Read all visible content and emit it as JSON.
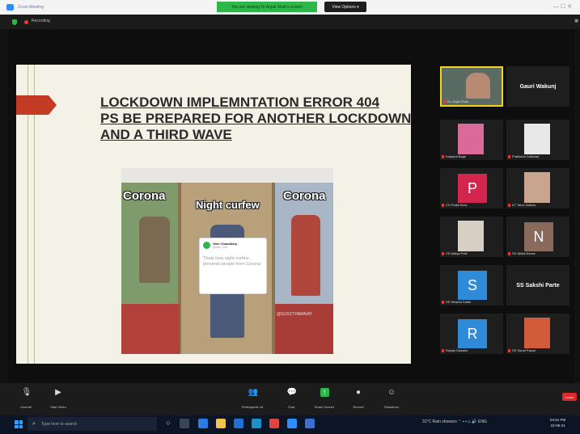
{
  "window": {
    "title": "Zoom Meeting"
  },
  "share_banner": {
    "label": "You are viewing Dr Anjali Shah's screen",
    "view_options": "View Options ▾"
  },
  "rec_bar": {
    "recording": "Recording"
  },
  "slide": {
    "title_lines": [
      "LOCKDOWN IMPLEMNTATION ERROR 404",
      "PS BE PREPARED FOR ANOTHER LOCKDOWN",
      "AND A THIRD WAVE"
    ],
    "meme_labels": {
      "left": "Corona",
      "middle": "Night curfew",
      "right": "Corona"
    },
    "tweet": {
      "name": "Vani Chaudhary",
      "handle": "@vani_chd",
      "text": "Thats how night curfew prevents people from Corona"
    },
    "watermark": "@SUSSTYAMAVAT"
  },
  "participants": [
    {
      "name": "Dr. Anjali Shah",
      "type": "video",
      "active": true
    },
    {
      "name": "Gauri Wakunj",
      "type": "name-only"
    },
    {
      "name": "Kalpana Bage",
      "type": "photo"
    },
    {
      "name": "Pratiksha Gaikwad",
      "type": "photo"
    },
    {
      "name": "CS Pratik Bora",
      "type": "letter",
      "letter": "P",
      "color": "#d3264f"
    },
    {
      "name": "KT Tanvi Jadhav",
      "type": "photo"
    },
    {
      "name": "CS Aditya Patil",
      "type": "photo"
    },
    {
      "name": "SS Nikita Nevse",
      "type": "letter",
      "letter": "N",
      "color": "#8a6a5c"
    },
    {
      "name": "SS Shweta Sable",
      "type": "letter",
      "letter": "S",
      "color": "#2f8bd8"
    },
    {
      "name": "SS Sakshi Parte",
      "type": "name-only"
    },
    {
      "name": "Rutuja Gawade",
      "type": "letter",
      "letter": "R",
      "color": "#2f8bd8"
    },
    {
      "name": "SS Sonal Pawar",
      "type": "photo"
    }
  ],
  "toolbar": {
    "unmute": "Unmute",
    "start_video": "Start Video",
    "participants": "Participants",
    "participants_count": "16",
    "chat": "Chat",
    "share_screen": "Share Screen",
    "record": "Record",
    "reactions": "Reactions",
    "end": "Leave"
  },
  "taskbar": {
    "search_placeholder": "Type here to search",
    "weather": "31°C Rain showers",
    "language": "ENG",
    "time": "04:51 PM",
    "date": "22-06-21"
  }
}
